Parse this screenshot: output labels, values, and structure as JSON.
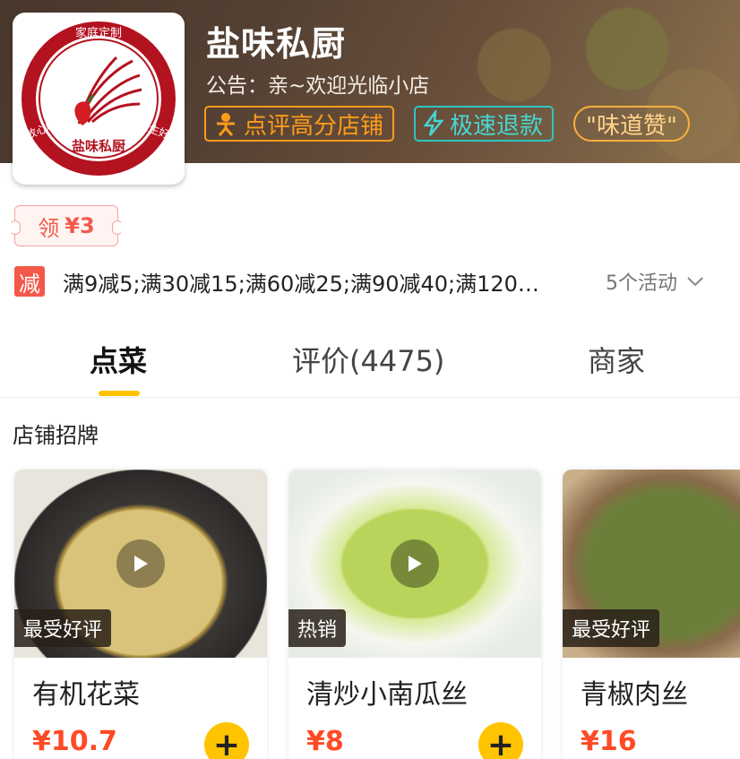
{
  "header": {
    "shop_name": "盐味私厨",
    "notice": "公告：亲~欢迎光临小店",
    "tags": [
      {
        "label": "点评高分店铺",
        "icon": "person-icon",
        "color": "#ff9b1a"
      },
      {
        "label": "极速退款",
        "icon": "lightning-icon",
        "color": "#2fc4c2"
      },
      {
        "label": "\"味道赞\"",
        "color": "#ffae3a"
      }
    ]
  },
  "logo": {
    "top_text": "家庭定制",
    "center_text": "盐味私厨",
    "left_text": "放心吃",
    "right_text": "卫生好"
  },
  "coupon": {
    "label": "领",
    "amount": "¥3"
  },
  "promo": {
    "badge": "减",
    "text": "满9减5;满30减15;满60减25;满90减40;满120…",
    "activities": "5个活动"
  },
  "tabs": [
    {
      "label": "点菜",
      "active": true
    },
    {
      "label": "评价(4475)",
      "active": false
    },
    {
      "label": "商家",
      "active": false
    }
  ],
  "section_title": "店铺招牌",
  "dishes": [
    {
      "name": "有机花菜",
      "price": "¥10.7",
      "badge": "最受好评"
    },
    {
      "name": "清炒小南瓜丝",
      "price": "¥8",
      "badge": "热销"
    },
    {
      "name": "青椒肉丝",
      "price": "¥16",
      "badge": "最受好评"
    }
  ],
  "colors": {
    "accent": "#ffc300",
    "price": "#ff4a26",
    "promo_red": "#f4584a"
  }
}
